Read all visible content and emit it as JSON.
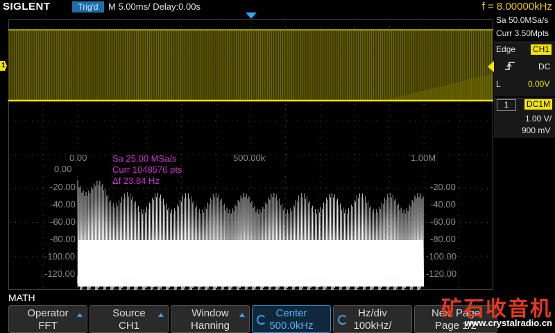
{
  "brand": "SIGLENT",
  "status": {
    "trigger_state": "Trig'd",
    "timebase": "M 5.00ms/ Delay:0.00s",
    "frequency": "f = 8.00000kHz"
  },
  "acquisition": {
    "sample_rate": "Sa 50.0MSa/s",
    "memory": "Curr 3.50Mpts"
  },
  "trigger": {
    "type_label": "Edge",
    "source": "CH1",
    "coupling": "DC",
    "slope_label": "L",
    "level": "0.00V"
  },
  "channel1": {
    "number": "1",
    "coupling": "DC1M",
    "scale": "1.00 V/",
    "offset": "900 mV",
    "marker": "1"
  },
  "fft": {
    "sample_rate": "Sa 25.00 MSa/s",
    "points": "Curr 1048576 pts",
    "resolution": "Δf 23.84 Hz",
    "x_ticks": [
      "0.00",
      "500.00k",
      "1.00M"
    ],
    "y_ticks_left": [
      "0.00",
      "-20.00",
      "-40.00",
      "-60.00",
      "-80.00",
      "-100.00",
      "-120.00"
    ],
    "y_ticks_right": [
      "-20.00",
      "-40.00",
      "-60.00",
      "-80.00",
      "-100.00",
      "-120.00"
    ]
  },
  "math_label": "MATH",
  "menu": [
    {
      "title": "Operator",
      "value": "FFT"
    },
    {
      "title": "Source",
      "value": "CH1"
    },
    {
      "title": "Window",
      "value": "Hanning"
    },
    {
      "title": "Center",
      "value": "500.0kHz"
    },
    {
      "title": "Hz/div",
      "value": "100kHz/"
    },
    {
      "title": "Next Page",
      "value": "Page 1/2"
    }
  ],
  "watermark": {
    "text": "矿石收音机",
    "url": "www.crystalradio.cn"
  },
  "colors": {
    "ch1": "#f2e400",
    "math": "#d22fd2",
    "accent": "#2a8fd6"
  }
}
